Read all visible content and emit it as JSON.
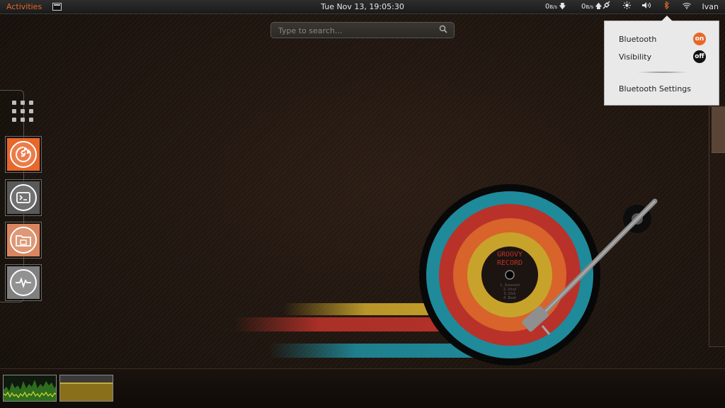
{
  "top_bar": {
    "activities": "Activities",
    "clock": "Tue Nov 13, 19:05:30",
    "net_down": {
      "value": "0",
      "unit": "B/s"
    },
    "net_up": {
      "value": "0",
      "unit": "B/s"
    },
    "user": "Ivan",
    "icons": [
      "terminal-icon",
      "download-arrow-icon",
      "upload-arrow-icon",
      "network-plug-icon",
      "brightness-icon",
      "volume-icon",
      "bluetooth-icon",
      "wifi-icon"
    ]
  },
  "search": {
    "placeholder": "Type to search..."
  },
  "bluetooth_menu": {
    "bluetooth_label": "Bluetooth",
    "bluetooth_state": "on",
    "visibility_label": "Visibility",
    "visibility_state": "off",
    "settings_label": "Bluetooth Settings"
  },
  "dash": {
    "items": [
      {
        "name": "firefox",
        "icon": "firefox-icon"
      },
      {
        "name": "terminal",
        "icon": "terminal-icon"
      },
      {
        "name": "files",
        "icon": "folder-icon"
      },
      {
        "name": "system-monitor",
        "icon": "pulse-icon"
      }
    ]
  },
  "wallpaper": {
    "record_title": [
      "GROOVY",
      "RECORD"
    ],
    "record_tracks": [
      "1. Grooved",
      "2. Vinyl",
      "3. Disk",
      "4. Beat"
    ]
  },
  "colors": {
    "accent": "#e8672b",
    "menu_bg": "#e9e9e9",
    "ring_teal": "#1f8a9a",
    "ring_red": "#b8322a",
    "ring_orange": "#d8632b",
    "ring_yellow": "#c8a32b"
  }
}
